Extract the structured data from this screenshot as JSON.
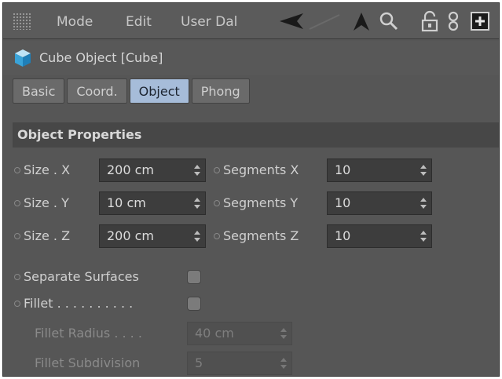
{
  "menu": {
    "mode": "Mode",
    "edit": "Edit",
    "user_data": "User Dal"
  },
  "toolbar_icons": [
    "arrow-left-icon",
    "arrow-up-icon",
    "search-icon",
    "lock-icon",
    "link-icon",
    "new-panel-icon"
  ],
  "object": {
    "icon": "cube-icon",
    "title": "Cube Object [Cube]"
  },
  "tabs": [
    {
      "label": "Basic",
      "active": false
    },
    {
      "label": "Coord.",
      "active": false
    },
    {
      "label": "Object",
      "active": true
    },
    {
      "label": "Phong",
      "active": false
    }
  ],
  "section": {
    "title": "Object Properties"
  },
  "size_x": {
    "label": "Size . X",
    "value": "200 cm"
  },
  "size_y": {
    "label": "Size . Y",
    "value": "10 cm"
  },
  "size_z": {
    "label": "Size . Z",
    "value": "200 cm"
  },
  "seg_x": {
    "label": "Segments X",
    "value": "10"
  },
  "seg_y": {
    "label": "Segments Y",
    "value": "10"
  },
  "seg_z": {
    "label": "Segments Z",
    "value": "10"
  },
  "separate_surfaces": {
    "label": "Separate Surfaces",
    "checked": false
  },
  "fillet": {
    "label": "Fillet . . . . . . . . . .",
    "checked": false
  },
  "fillet_radius": {
    "label": "Fillet Radius . . . .",
    "value": "40 cm"
  },
  "fillet_subdivision": {
    "label": "Fillet Subdivision",
    "value": "5"
  },
  "colors": {
    "panel": "#565656",
    "active_tab": "#a6bcd9",
    "field": "#3d3d3d",
    "section": "#474747"
  }
}
